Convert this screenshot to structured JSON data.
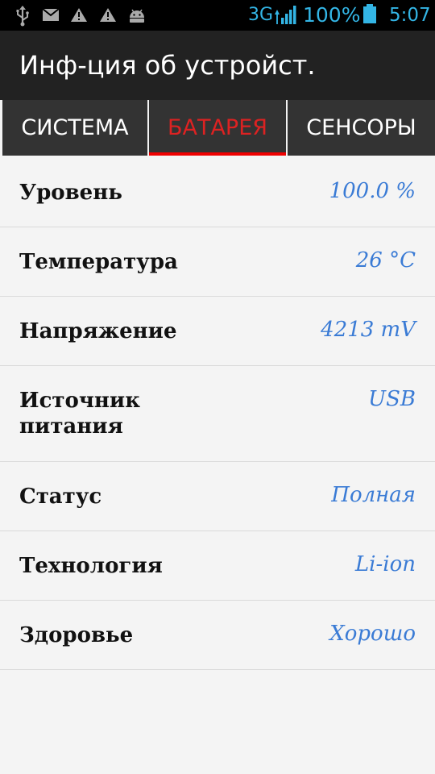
{
  "status_bar": {
    "network": "3G",
    "battery_percent": "100%",
    "time": "5:07",
    "icons": [
      "usb-icon",
      "mail-icon",
      "warning-icon",
      "warning-icon",
      "android-icon",
      "signal-icon",
      "battery-icon"
    ],
    "accent_color": "#33b5e5"
  },
  "action_bar": {
    "title": "Инф-ция об устройст."
  },
  "tabs": [
    {
      "label": "СИСТЕМА",
      "active": false
    },
    {
      "label": "БАТАРЕЯ",
      "active": true
    },
    {
      "label": "СЕНСОРЫ",
      "active": false
    }
  ],
  "battery_info": [
    {
      "label": "Уровень",
      "value": "100.0 %"
    },
    {
      "label": "Температура",
      "value": "26 °C"
    },
    {
      "label": "Напряжение",
      "value": "4213 mV"
    },
    {
      "label": "Источник питания",
      "value": "USB"
    },
    {
      "label": "Статус",
      "value": "Полная"
    },
    {
      "label": "Технология",
      "value": "Li-ion"
    },
    {
      "label": "Здоровье",
      "value": "Хорошо"
    }
  ],
  "colors": {
    "active_tab": "#dd2222",
    "value_text": "#3a7bd5"
  }
}
